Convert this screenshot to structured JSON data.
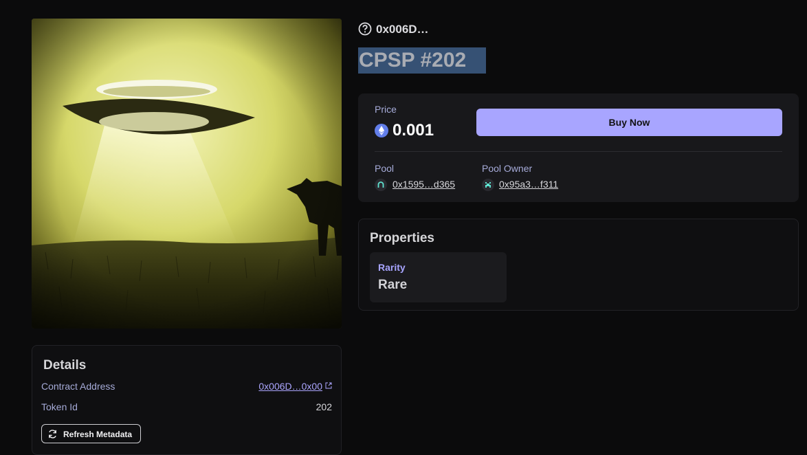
{
  "nft": {
    "collection_name": "0x006D…",
    "title": "CPSP #202"
  },
  "price": {
    "label": "Price",
    "value": "0.001",
    "currency_icon": "ethereum-icon"
  },
  "actions": {
    "buy_label": "Buy Now",
    "refresh_label": "Refresh Metadata"
  },
  "pool": {
    "label": "Pool",
    "address": "0x1595…d365",
    "owner_label": "Pool Owner",
    "owner_address": "0x95a3…f311"
  },
  "properties": {
    "title": "Properties",
    "items": [
      {
        "trait": "Rarity",
        "value": "Rare"
      }
    ]
  },
  "details": {
    "title": "Details",
    "rows": [
      {
        "key": "Contract Address",
        "value": "0x006D…0x00"
      },
      {
        "key": "Token Id",
        "value": "202"
      }
    ]
  },
  "colors": {
    "accent": "#a8a5ff",
    "background": "#0b0b0c",
    "card": "#18181b",
    "title_selection": "#365174"
  }
}
